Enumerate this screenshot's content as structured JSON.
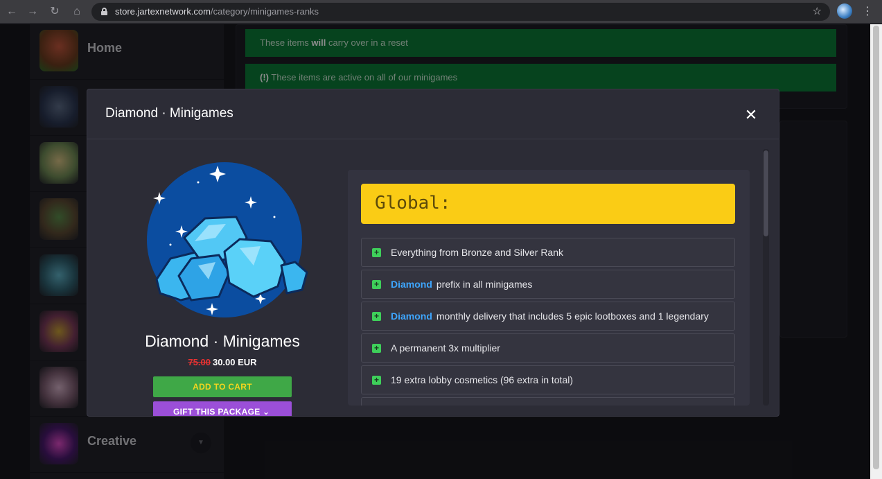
{
  "browser": {
    "back_icon": "arrow-left-icon",
    "forward_icon": "arrow-right-icon",
    "reload_icon": "reload-icon",
    "home_icon": "home-icon",
    "url_host": "store.jartexnetwork.com",
    "url_path": "/category/minigames-ranks"
  },
  "sidebar": {
    "items": [
      {
        "label": "Home"
      },
      {
        "label": ""
      },
      {
        "label": ""
      },
      {
        "label": ""
      },
      {
        "label": ""
      },
      {
        "label": ""
      },
      {
        "label": ""
      },
      {
        "label": "Creative"
      }
    ]
  },
  "notices": {
    "carry_prefix": "These items ",
    "carry_bold": "will",
    "carry_suffix": " carry over in a reset",
    "active_bold": "(!)",
    "active_text": " These items are active on all of our minigames"
  },
  "modal": {
    "title": "Diamond · Minigames",
    "close": "✕",
    "package_name": "Diamond · Minigames",
    "old_price": "75.00",
    "price": "30.00 EUR",
    "add_to_cart": "ADD TO CART",
    "gift": "GIFT THIS PACKAGE",
    "section_title": "Global:",
    "features": [
      {
        "highlight": "",
        "text": "Everything from Bronze and Silver Rank"
      },
      {
        "highlight": "Diamond",
        "text": "prefix in all minigames"
      },
      {
        "highlight": "Diamond",
        "text": "monthly delivery that includes 5 epic lootboxes and 1 legendary"
      },
      {
        "highlight": "",
        "text": "A permanent 3x multiplier"
      },
      {
        "highlight": "",
        "text": "19 extra lobby cosmetics (96 extra in total)"
      }
    ]
  },
  "colors": {
    "notice_green": "#0c7a37",
    "banner_yellow": "#facc15",
    "add_cart_green": "#3fa847",
    "gift_purple": "#9b4fd8",
    "old_price_red": "#e83232"
  }
}
